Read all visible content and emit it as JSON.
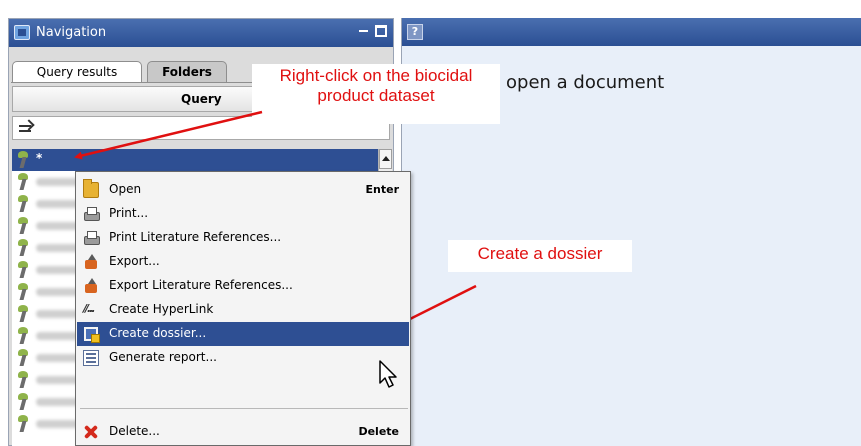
{
  "navigation": {
    "title": "Navigation",
    "tabs": [
      {
        "label": "Query results",
        "active": true
      },
      {
        "label": "Folders",
        "active": false
      }
    ],
    "query_column_header": "Query",
    "selected_row": {
      "name": "*",
      "selected": true
    },
    "list_rows_count_visible": 12
  },
  "editor": {
    "help_icon_label": "?",
    "placeholder_text": "open a document"
  },
  "context_menu": {
    "items": [
      {
        "label": "Open",
        "shortcut": "Enter",
        "icon": "folder-icon"
      },
      {
        "label": "Print...",
        "shortcut": "",
        "icon": "printer-icon"
      },
      {
        "label": "Print Literature References...",
        "shortcut": "",
        "icon": "printer-icon"
      },
      {
        "label": "Export...",
        "shortcut": "",
        "icon": "export-icon"
      },
      {
        "label": "Export Literature References...",
        "shortcut": "",
        "icon": "export-icon"
      },
      {
        "label": "Create HyperLink",
        "shortcut": "",
        "icon": "hyperlink-icon",
        "icon_text": "//..."
      },
      {
        "label": "Create dossier...",
        "shortcut": "",
        "icon": "dossier-icon",
        "highlighted": true
      },
      {
        "label": "Generate report...",
        "shortcut": "",
        "icon": "report-icon"
      },
      {
        "label": "Delete...",
        "shortcut": "Delete",
        "icon": "delete-icon"
      }
    ]
  },
  "callouts": {
    "right_click": "Right-click on the biocidal product dataset",
    "create_dossier": "Create a dossier"
  },
  "colors": {
    "titlebar": "#2b4f93",
    "selection": "#2e4f93",
    "callout_text": "#e01010",
    "editor_background": "#e8eff9"
  }
}
